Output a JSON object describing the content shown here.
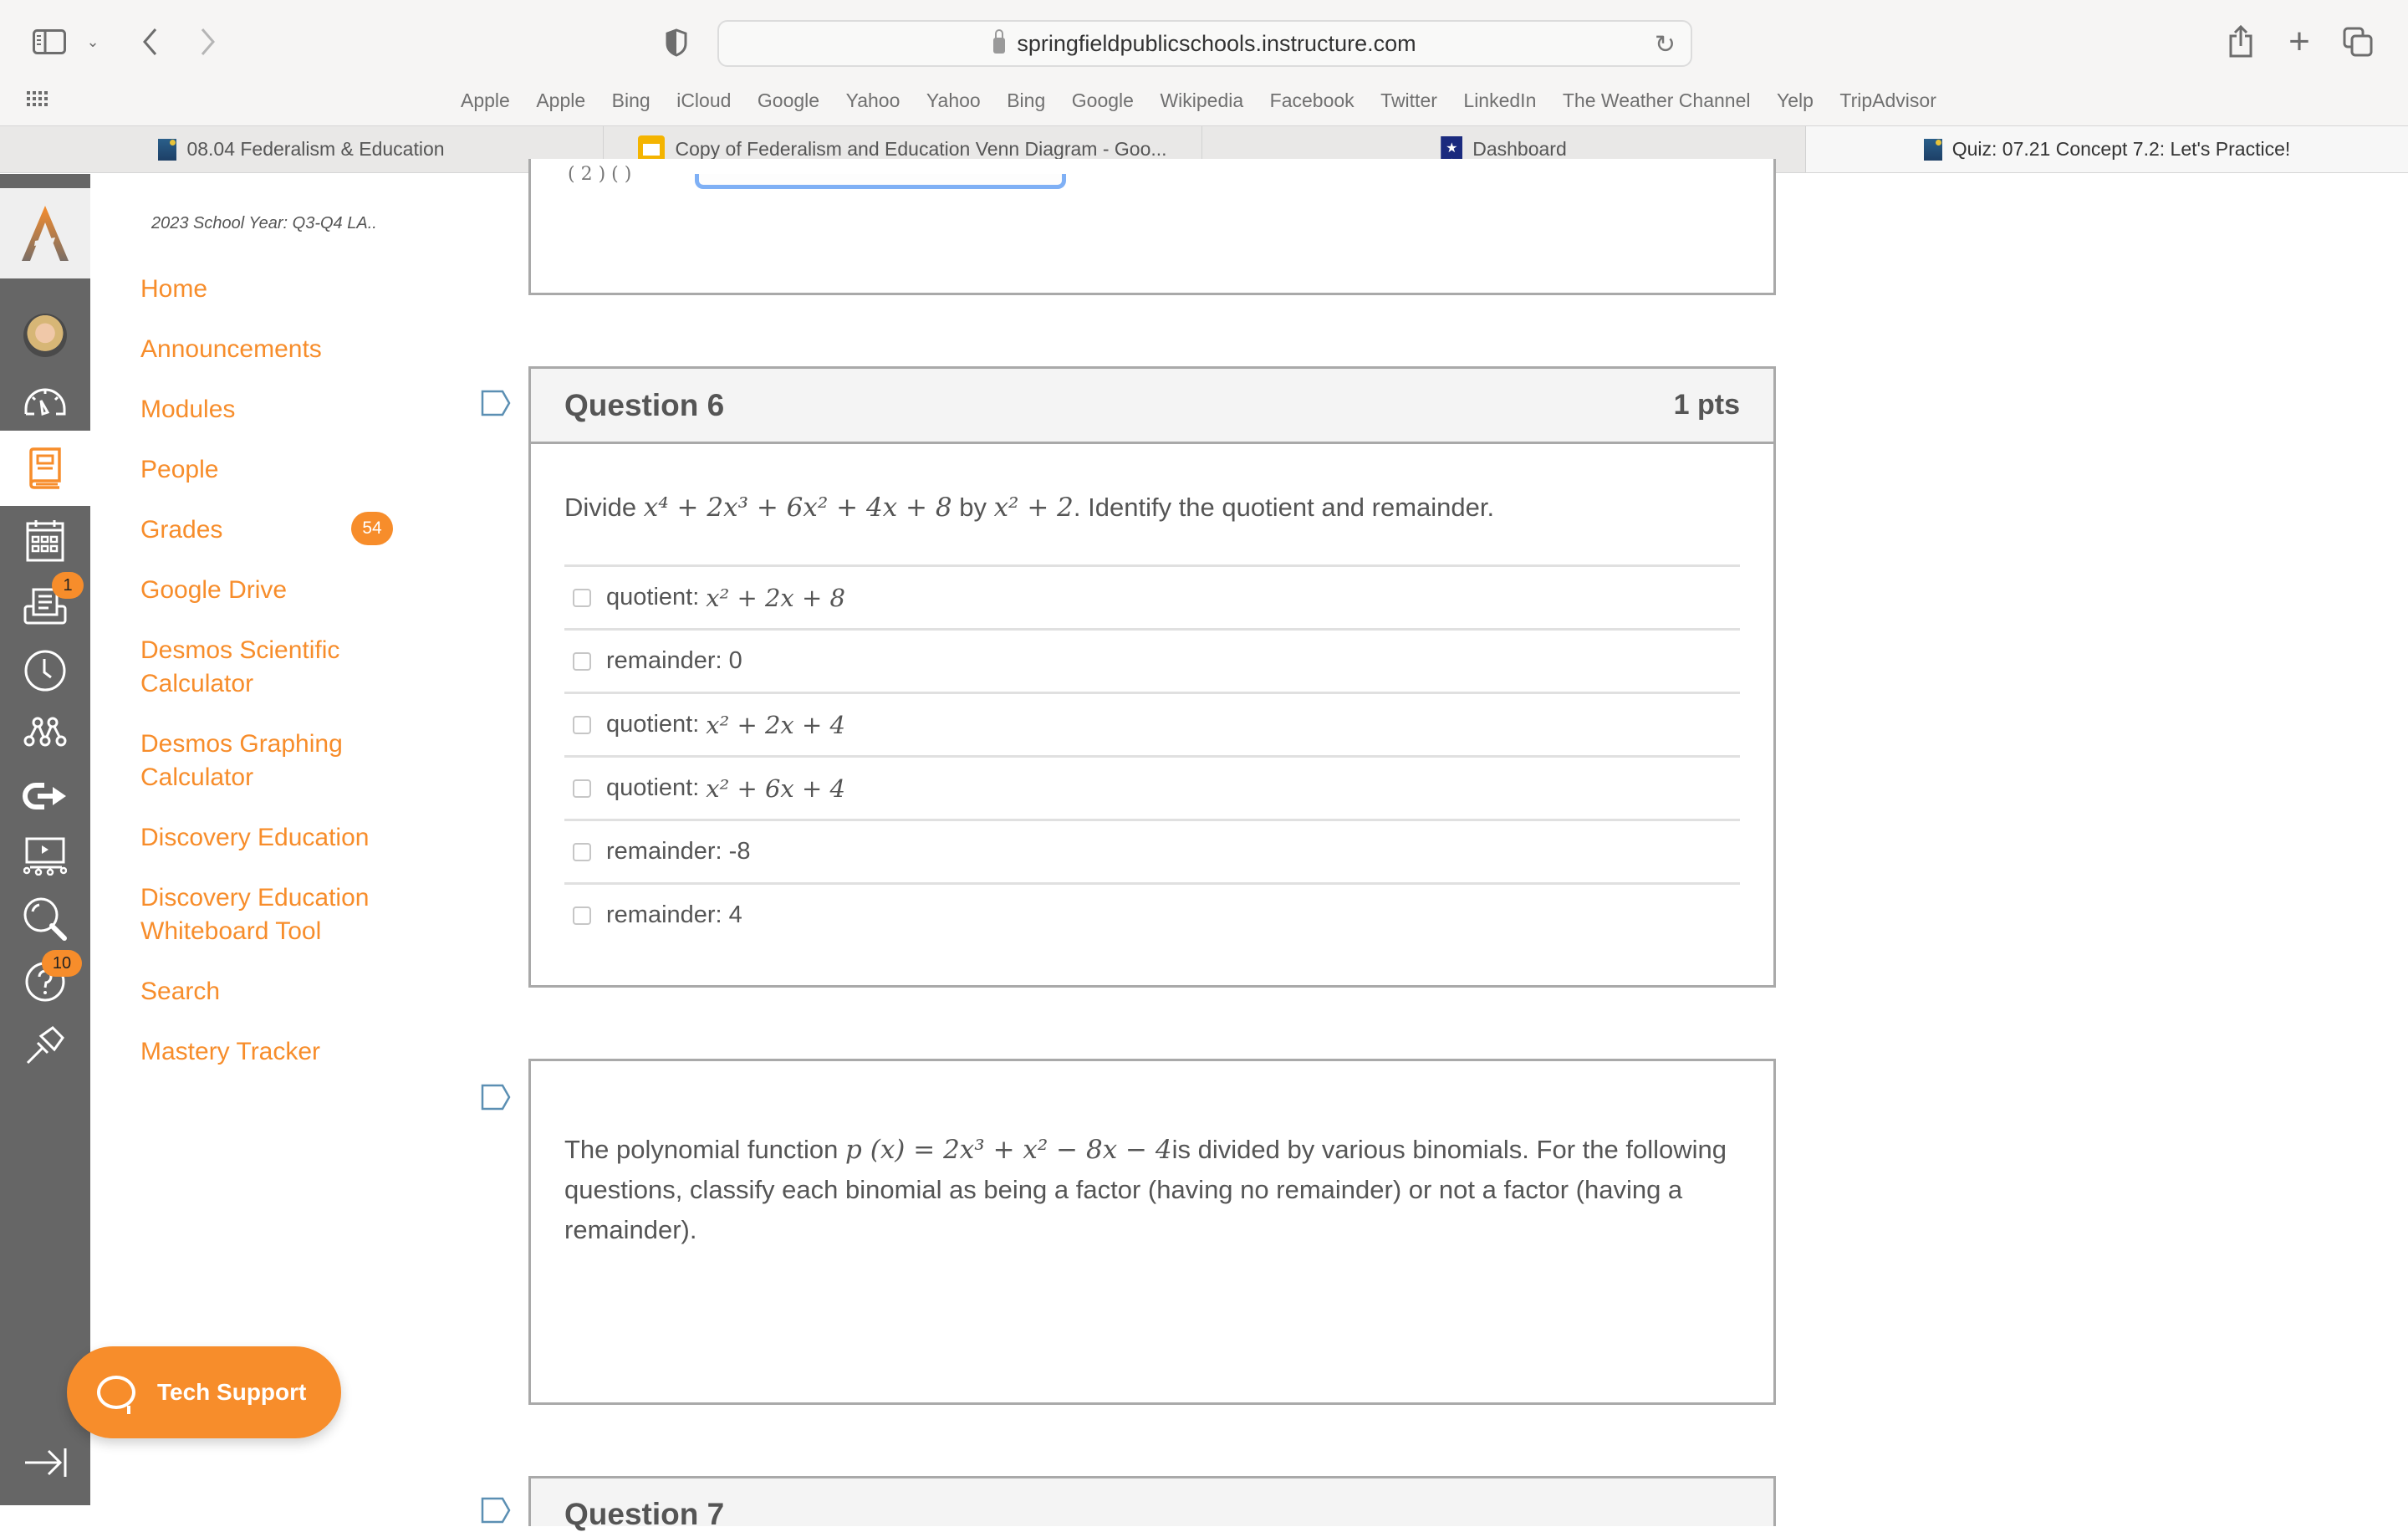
{
  "browser": {
    "url": "springfieldpublicschools.instructure.com",
    "bookmarks": [
      "Apple",
      "Apple",
      "Bing",
      "iCloud",
      "Google",
      "Yahoo",
      "Yahoo",
      "Bing",
      "Google",
      "Wikipedia",
      "Facebook",
      "Twitter",
      "LinkedIn",
      "The Weather Channel",
      "Yelp",
      "TripAdvisor"
    ],
    "tabs": [
      {
        "label": "08.04 Federalism & Education",
        "icon": "sps-favicon",
        "active": false
      },
      {
        "label": "Copy of Federalism and Education Venn Diagram - Goo...",
        "icon": "google-slides-favicon",
        "active": false
      },
      {
        "label": "Dashboard",
        "icon": "dashboard-shield-favicon",
        "active": false
      },
      {
        "label": "Quiz: 07.21 Concept 7.2: Let's Practice!",
        "icon": "sps-favicon",
        "active": true
      }
    ]
  },
  "global_nav": {
    "items": [
      {
        "name": "account",
        "icon": "avatar"
      },
      {
        "name": "dashboard",
        "icon": "speedometer-icon"
      },
      {
        "name": "courses",
        "icon": "book-icon",
        "active": true
      },
      {
        "name": "calendar",
        "icon": "calendar-icon"
      },
      {
        "name": "inbox",
        "icon": "inbox-icon",
        "badge": "1"
      },
      {
        "name": "history",
        "icon": "clock-icon"
      },
      {
        "name": "commons",
        "icon": "network-icon"
      },
      {
        "name": "studio",
        "icon": "arrow-loop-icon"
      },
      {
        "name": "media",
        "icon": "presentation-icon"
      },
      {
        "name": "search",
        "icon": "magnifier-icon"
      },
      {
        "name": "help",
        "icon": "help-icon",
        "badge": "10"
      },
      {
        "name": "pin",
        "icon": "pin-icon"
      }
    ],
    "collapse_icon": "collapse-arrow-icon"
  },
  "course_nav": {
    "course_title": "2023 School Year: Q3-Q4 LA..",
    "links": [
      "Home",
      "Announcements",
      "Modules",
      "People",
      "Grades",
      "Google Drive",
      "Desmos Scientific Calculator",
      "Desmos Graphing Calculator",
      "Discovery Education",
      "Discovery Education Whiteboard Tool",
      "Search",
      "Mastery Tracker"
    ],
    "grades_badge": "54"
  },
  "tech_support": {
    "label": "Tech Support"
  },
  "questions": {
    "q6": {
      "title": "Question 6",
      "points": "1 pts",
      "prompt_prefix": "Divide ",
      "prompt_dividend": "x⁴ + 2x³ + 6x² + 4x + 8",
      "prompt_mid": " by ",
      "prompt_divisor": "x² + 2",
      "prompt_suffix": ". Identify the quotient and remainder.",
      "options": [
        {
          "label": "quotient: ",
          "math": "x² + 2x + 8",
          "checked": false
        },
        {
          "label": "remainder: 0",
          "math": "",
          "checked": false
        },
        {
          "label": "quotient: ",
          "math": "x² + 2x + 4",
          "checked": false
        },
        {
          "label": "quotient: ",
          "math": "x² + 6x + 4",
          "checked": false
        },
        {
          "label": "remainder: -8",
          "math": "",
          "checked": false
        },
        {
          "label": "remainder: 4",
          "math": "",
          "checked": false
        }
      ]
    },
    "q_next": {
      "text_prefix": "The polynomial function ",
      "text_math": "p (x) = 2x³ + x² − 8x − 4",
      "text_suffix": "is divided by various binomials. For the following questions, classify each binomial as being a factor (having no remainder) or not a factor (having a remainder)."
    },
    "q7_header_partial": "Question 7"
  },
  "colors": {
    "accent": "#f78d2b",
    "global_nav_bg": "#666666",
    "question_border": "#a9a9a9",
    "focus_ring": "#7fb0f5"
  }
}
